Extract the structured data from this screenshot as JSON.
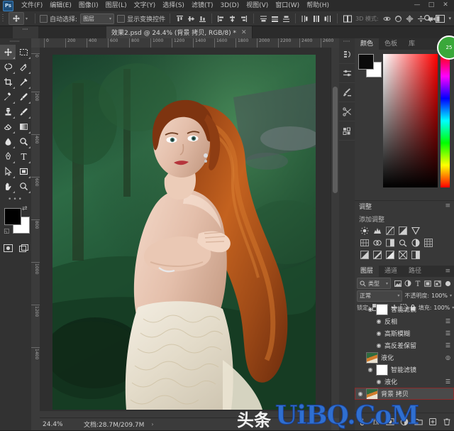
{
  "app": {
    "name": "Adobe Photoshop",
    "logo_text": "Ps"
  },
  "menubar": {
    "items": [
      {
        "label": "文件(F)"
      },
      {
        "label": "编辑(E)"
      },
      {
        "label": "图像(I)"
      },
      {
        "label": "图层(L)"
      },
      {
        "label": "文字(Y)"
      },
      {
        "label": "选择(S)"
      },
      {
        "label": "滤镜(T)"
      },
      {
        "label": "3D(D)"
      },
      {
        "label": "视图(V)"
      },
      {
        "label": "窗口(W)"
      },
      {
        "label": "帮助(H)"
      }
    ],
    "window_controls": {
      "minimize": "—",
      "maximize": "□",
      "close": "✕"
    }
  },
  "options_bar": {
    "tool_icon": "move-tool-icon",
    "auto_select_label": "自动选择:",
    "auto_select_checked": false,
    "layer_dropdown_value": "图层",
    "show_transform_label": "显示变换控件",
    "show_transform_checked": false,
    "mode_3d_label": "3D 模式:",
    "align_icons": [
      "align-top-edges-icon",
      "align-vertical-centers-icon",
      "align-bottom-edges-icon",
      "align-left-edges-icon",
      "align-horizontal-centers-icon",
      "align-right-edges-icon"
    ],
    "distribute_icons": [
      "distribute-top-icon",
      "distribute-vertical-center-icon",
      "distribute-bottom-icon",
      "distribute-left-icon",
      "distribute-horizontal-center-icon",
      "distribute-right-icon"
    ],
    "extra_icons": [
      "auto-align-icon"
    ],
    "mode_3d_icons": [
      "orbit-3d-icon",
      "roll-3d-icon",
      "pan-3d-icon",
      "slide-3d-icon",
      "camera-3d-icon"
    ],
    "right_icons": [
      "search-icon",
      "workspace-icon",
      "chevron-down-icon"
    ]
  },
  "document_tab": {
    "title": "效果2.psd @ 24.4% (背景 拷贝, RGB/8) *",
    "close": "✕"
  },
  "toolbar": {
    "tools": [
      {
        "name": "move-tool",
        "glyph": "move",
        "selected": true
      },
      {
        "name": "rectangular-marquee-tool",
        "glyph": "marquee",
        "selected": false
      },
      {
        "name": "lasso-tool",
        "glyph": "lasso",
        "selected": false
      },
      {
        "name": "quick-selection-tool",
        "glyph": "quickselect",
        "selected": false
      },
      {
        "name": "crop-tool",
        "glyph": "crop",
        "selected": false
      },
      {
        "name": "eyedropper-tool",
        "glyph": "eyedropper",
        "selected": false
      },
      {
        "name": "spot-healing-brush-tool",
        "glyph": "healing",
        "selected": false
      },
      {
        "name": "brush-tool",
        "glyph": "brush",
        "selected": false
      },
      {
        "name": "clone-stamp-tool",
        "glyph": "stamp",
        "selected": false
      },
      {
        "name": "history-brush-tool",
        "glyph": "historybrush",
        "selected": false
      },
      {
        "name": "eraser-tool",
        "glyph": "eraser",
        "selected": false
      },
      {
        "name": "gradient-tool",
        "glyph": "gradient",
        "selected": false
      },
      {
        "name": "blur-tool",
        "glyph": "blur",
        "selected": false
      },
      {
        "name": "dodge-tool",
        "glyph": "dodge",
        "selected": false
      },
      {
        "name": "pen-tool",
        "glyph": "pen",
        "selected": false
      },
      {
        "name": "horizontal-type-tool",
        "glyph": "type",
        "selected": false
      },
      {
        "name": "path-selection-tool",
        "glyph": "pathselect",
        "selected": false
      },
      {
        "name": "rectangle-tool",
        "glyph": "rectangle",
        "selected": false
      },
      {
        "name": "hand-tool",
        "glyph": "hand",
        "selected": false
      },
      {
        "name": "zoom-tool",
        "glyph": "zoom",
        "selected": false
      }
    ],
    "more_tools": "•••",
    "foreground_color": "#000000",
    "background_color": "#ffffff",
    "swap_icon": "swap-colors-icon",
    "default_icon": "default-colors-icon",
    "quick_mask_icon": "quick-mask-icon",
    "screen_mode_icon": "screen-mode-icon"
  },
  "canvas": {
    "ruler_h_ticks": [
      "0",
      "200",
      "400",
      "600",
      "800",
      "1000",
      "1200",
      "1400",
      "1600",
      "1800",
      "2000",
      "2200",
      "2400",
      "2600"
    ],
    "ruler_v_ticks": [
      "0",
      "200",
      "400",
      "600",
      "800",
      "1000",
      "1200",
      "1400"
    ],
    "image_alt": "portrait-photo"
  },
  "status_bar": {
    "zoom": "24.4%",
    "doc_label": "文档:28.7M/209.7M",
    "arrow": "›"
  },
  "icon_dock": {
    "items": [
      {
        "name": "history-panel-icon"
      },
      {
        "name": "properties-panel-icon"
      },
      {
        "name": "brush-settings-panel-icon"
      },
      {
        "name": "actions-panel-icon"
      },
      {
        "name": "libraries-panel-icon"
      }
    ]
  },
  "color_panel": {
    "tabs": [
      {
        "label": "颜色",
        "active": true
      },
      {
        "label": "色板",
        "active": false
      },
      {
        "label": "库",
        "active": false
      }
    ],
    "menu_icon": "panel-menu-icon",
    "foreground": "#0a0a0a",
    "background": "#ffffff",
    "picker_base_color": "#ff0000"
  },
  "adjustments_panel": {
    "tab_label": "调整",
    "menu_icon": "panel-menu-icon",
    "section_label": "添加调整",
    "rows": [
      [
        "brightness-contrast-icon",
        "levels-icon",
        "curves-icon",
        "exposure-icon",
        "vibrance-icon"
      ],
      [
        "hue-saturation-icon",
        "color-balance-icon",
        "black-white-icon",
        "photo-filter-icon",
        "channel-mixer-icon",
        "color-lookup-icon"
      ],
      [
        "invert-icon",
        "posterize-icon",
        "threshold-icon",
        "gradient-map-icon",
        "selective-color-icon"
      ]
    ]
  },
  "layers_panel": {
    "tabs": [
      {
        "label": "图层",
        "active": true
      },
      {
        "label": "通道",
        "active": false
      },
      {
        "label": "路径",
        "active": false
      }
    ],
    "menu_icon": "panel-menu-icon",
    "filter": {
      "search_icon": "search-icon",
      "type_label": "类型",
      "chevron": "⌄",
      "kind_icons": [
        "filter-pixel-icon",
        "filter-adjustment-icon",
        "filter-type-icon",
        "filter-shape-icon",
        "filter-smartobject-icon"
      ],
      "toggle_icon": "filter-toggle-icon"
    },
    "blend_mode": "正常",
    "opacity_label": "不透明度:",
    "opacity_value": "100%",
    "lock_label": "锁定:",
    "lock_icons": [
      "lock-transparent-icon",
      "lock-image-icon",
      "lock-position-icon",
      "lock-artboard-icon",
      "lock-all-icon"
    ],
    "fill_label": "填充:",
    "fill_value": "100%",
    "rows": [
      {
        "name": "智能滤镜",
        "indent": 1,
        "eye": "◉",
        "thumb": "mask",
        "fx": "",
        "selected": false,
        "kind": "smart-filters"
      },
      {
        "name": "反相",
        "indent": 2,
        "eye": "◉",
        "thumb": "none",
        "fx": "☰",
        "selected": false,
        "kind": "filter"
      },
      {
        "name": "高斯模糊",
        "indent": 2,
        "eye": "◉",
        "thumb": "none",
        "fx": "☰",
        "selected": false,
        "kind": "filter"
      },
      {
        "name": "高反差保留",
        "indent": 2,
        "eye": "◉",
        "thumb": "none",
        "fx": "☰",
        "selected": false,
        "kind": "filter"
      },
      {
        "name": "液化",
        "indent": 0,
        "eye": "",
        "thumb": "photo",
        "fx": "◎",
        "selected": false,
        "kind": "layer"
      },
      {
        "name": "智能滤镜",
        "indent": 1,
        "eye": "◉",
        "thumb": "mask",
        "fx": "",
        "selected": false,
        "kind": "smart-filters"
      },
      {
        "name": "液化",
        "indent": 2,
        "eye": "◉",
        "thumb": "none",
        "fx": "☰",
        "selected": false,
        "kind": "filter"
      },
      {
        "name": "背景 拷贝",
        "indent": 0,
        "eye": "◉",
        "thumb": "photo",
        "fx": "",
        "selected": true,
        "kind": "layer"
      }
    ],
    "bottom_icons": [
      "link-layers-icon",
      "layer-style-icon",
      "add-mask-icon",
      "adjustment-layer-icon",
      "new-group-icon",
      "new-layer-icon",
      "delete-layer-icon"
    ]
  },
  "watermark": {
    "text_latin": "UiBQ.CoM",
    "text_cn": "头条",
    "color": "#2f6fd0"
  },
  "badge": {
    "text": "25",
    "color": "#3aa83a"
  }
}
